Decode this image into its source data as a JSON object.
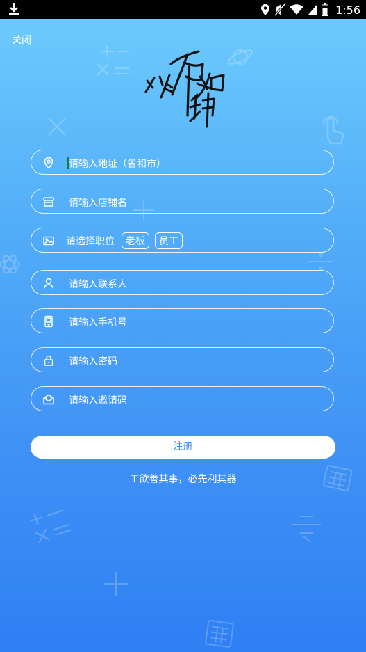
{
  "status_bar": {
    "time": "1:56",
    "icons": [
      "download-icon",
      "location-icon",
      "mute-icon",
      "wifi-icon",
      "signal-icon",
      "battery-icon"
    ]
  },
  "close_label": "关闭",
  "logo_text": "料事如神",
  "form": {
    "address_placeholder": "请输入地址（省和市）",
    "shop_placeholder": "请输入店铺名",
    "position_label": "请选择职位",
    "position_options": [
      "老板",
      "员工"
    ],
    "contact_placeholder": "请输入联系人",
    "phone_placeholder": "请输入手机号",
    "password_placeholder": "请输入密码",
    "invite_placeholder": "请输入邀请码"
  },
  "register_label": "注册",
  "slogan": "工欲善其事，必先利其器",
  "colors": {
    "gradient_top": "#6fcdfd",
    "gradient_bottom": "#2f7ff4",
    "button_text": "#3b8ff4"
  }
}
